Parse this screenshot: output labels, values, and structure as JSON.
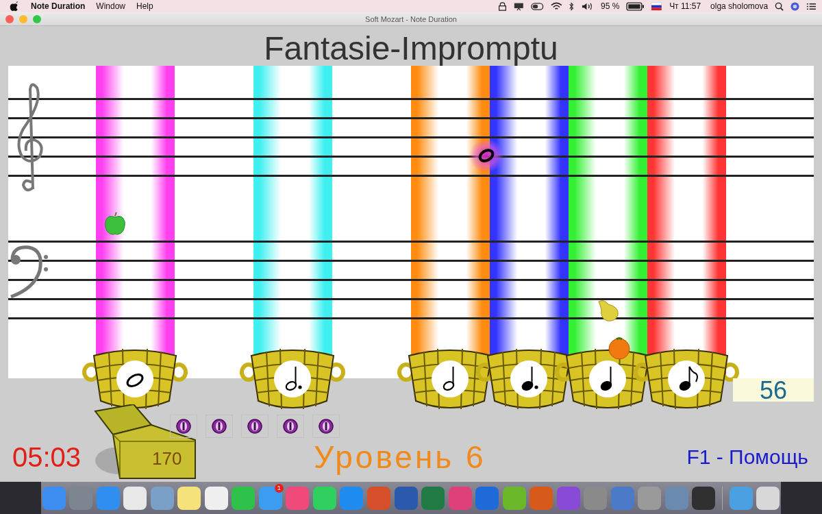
{
  "menu_bar": {
    "app_name": "Note Duration",
    "items": [
      "Window",
      "Help"
    ],
    "battery": "95 %",
    "clock": "Чт 11:57",
    "user": "olga sholomova"
  },
  "window": {
    "title": "Soft Mozart - Note Duration"
  },
  "game": {
    "title": "Fantasie-Impromptu",
    "lanes": [
      {
        "color": "#ff40f0",
        "kind": "whole"
      },
      {
        "color": "#40f0f0",
        "kind": "dotted-half"
      },
      {
        "color": "#ff8c10",
        "kind": "half"
      },
      {
        "color": "#3434ff",
        "kind": "dotted-quarter"
      },
      {
        "color": "#34f034",
        "kind": "quarter"
      },
      {
        "color": "#ff3434",
        "kind": "eighth"
      }
    ],
    "falling_note": {
      "kind": "whole"
    },
    "fruits": [
      {
        "kind": "apple"
      },
      {
        "kind": "pear"
      },
      {
        "kind": "orange"
      }
    ],
    "score": "56",
    "chest": {
      "count": "170"
    },
    "coins": [
      {
        "kind": "coin"
      },
      {
        "kind": "coin"
      },
      {
        "kind": "coin"
      },
      {
        "kind": "coin"
      },
      {
        "kind": "coin"
      }
    ],
    "timer": "05:03",
    "level": "Уровень 6",
    "help": "F1 - Помощь"
  },
  "dock": {
    "badge": "1"
  }
}
